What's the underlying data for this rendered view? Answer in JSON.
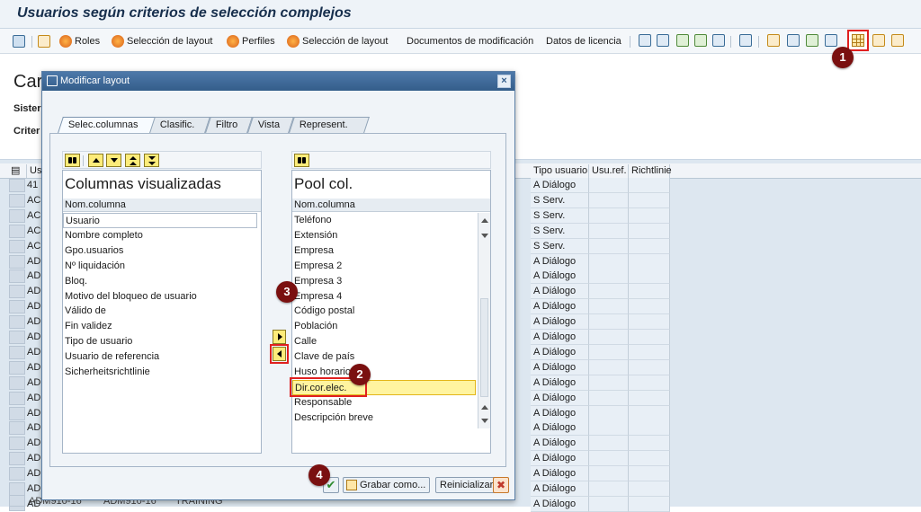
{
  "window": {
    "title": "Usuarios según criterios de selección complejos"
  },
  "toolbar": {
    "roles": "Roles",
    "layout_select_1": "Selección de layout",
    "profiles": "Perfiles",
    "layout_select_2": "Selección de layout",
    "change_docs": "Documentos de modificación",
    "license_data": "Datos de licencia"
  },
  "background": {
    "title_fragment": "Car",
    "label_1": "Sister",
    "label_2": "Criter",
    "grid_headers": {
      "user": "Usu",
      "user_type": "Tipo usuario",
      "ref_user": "Usu.ref.",
      "guideline": "Richtlinie"
    },
    "rows": [
      {
        "left": "41",
        "type": "A Diálogo"
      },
      {
        "left": "AC",
        "type": "S Serv."
      },
      {
        "left": "AC",
        "type": "S Serv."
      },
      {
        "left": "AC",
        "type": "S Serv."
      },
      {
        "left": "AC",
        "type": "S Serv."
      },
      {
        "left": "AD",
        "type": "A Diálogo"
      },
      {
        "left": "AD",
        "type": "A Diálogo"
      },
      {
        "left": "AD",
        "type": "A Diálogo"
      },
      {
        "left": "AD",
        "type": "A Diálogo"
      },
      {
        "left": "AD",
        "type": "A Diálogo"
      },
      {
        "left": "AD",
        "type": "A Diálogo"
      },
      {
        "left": "AD",
        "type": "A Diálogo"
      },
      {
        "left": "AD",
        "type": "A Diálogo"
      },
      {
        "left": "AD",
        "type": "A Diálogo"
      },
      {
        "left": "AD",
        "type": "A Diálogo"
      },
      {
        "left": "AD",
        "type": "A Diálogo"
      },
      {
        "left": "AD",
        "type": "A Diálogo"
      },
      {
        "left": "AD",
        "type": "A Diálogo"
      },
      {
        "left": "AD",
        "type": "A Diálogo"
      },
      {
        "left": "AD",
        "type": "A Diálogo"
      },
      {
        "left": "AD",
        "type": "A Diálogo"
      },
      {
        "left": "AD",
        "type": "A Diálogo"
      }
    ],
    "last_row": {
      "c1": "ADM910-16",
      "c2": "ADM910-16",
      "c3": "TRAINING"
    }
  },
  "dialog": {
    "title": "Modificar layout",
    "close": "×",
    "tabs": [
      "Selec.columnas",
      "Clasific.",
      "Filtro",
      "Vista",
      "Represent."
    ],
    "left_pane": {
      "heading": "Columnas visualizadas",
      "col_header": "Nom.columna",
      "items": [
        "Usuario",
        "Nombre completo",
        "Gpo.usuarios",
        "Nº liquidación",
        "Bloq.",
        "Motivo del bloqueo de usuario",
        "Válido de",
        "Fin validez",
        "Tipo de usuario",
        "Usuario de referencia",
        "Sicherheitsrichtlinie"
      ]
    },
    "right_pane": {
      "heading": "Pool col.",
      "col_header": "Nom.columna",
      "items": [
        "Teléfono",
        "Extensión",
        "Empresa",
        "Empresa 2",
        "Empresa 3",
        "Empresa 4",
        "Código postal",
        "Población",
        "Calle",
        "Clave de país",
        "Huso horario",
        "Dir.cor.elec.",
        "Responsable",
        "Descripción breve"
      ]
    },
    "buttons": {
      "ok": "✔",
      "save_as": "Grabar como...",
      "reset": "Reinicializar",
      "cancel": "✖"
    }
  },
  "annotations": {
    "b1": "1",
    "b2": "2",
    "b3": "3",
    "b4": "4"
  },
  "colors": {
    "highlight_red": "#e02020",
    "badge": "#7a1010",
    "selection_yellow": "#fff4a0"
  }
}
